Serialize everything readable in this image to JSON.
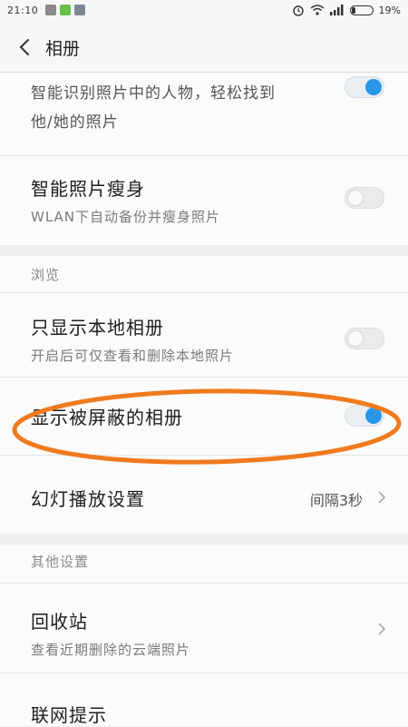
{
  "status_bar": {
    "time": "21:10",
    "battery": "19%",
    "battery_level": 0.19
  },
  "app_bar": {
    "title": "相册",
    "back_icon": "back-arrow-icon"
  },
  "settings": {
    "face_recognition": {
      "subtitle_line1": "智能识别照片中的人物，轻松找到",
      "subtitle_line2": "他/她的照片",
      "enabled": true
    },
    "photo_slim": {
      "title": "智能照片瘦身",
      "subtitle": "WLAN下自动备份并瘦身照片",
      "enabled": false
    },
    "browse_header": "浏览",
    "local_only": {
      "title": "只显示本地相册",
      "subtitle": "开启后可仅查看和删除本地照片",
      "enabled": false
    },
    "show_hidden": {
      "title": "显示被屏蔽的相册",
      "enabled": true
    },
    "slideshow": {
      "title": "幻灯播放设置",
      "value": "间隔3秒"
    },
    "other_header": "其他设置",
    "recycle_bin": {
      "title": "回收站",
      "subtitle": "查看近期删除的云端照片"
    },
    "network_prompt": {
      "title": "联网提示"
    }
  },
  "colors": {
    "accent": "#2a96ea",
    "highlight_oval": "#f07a1e"
  }
}
